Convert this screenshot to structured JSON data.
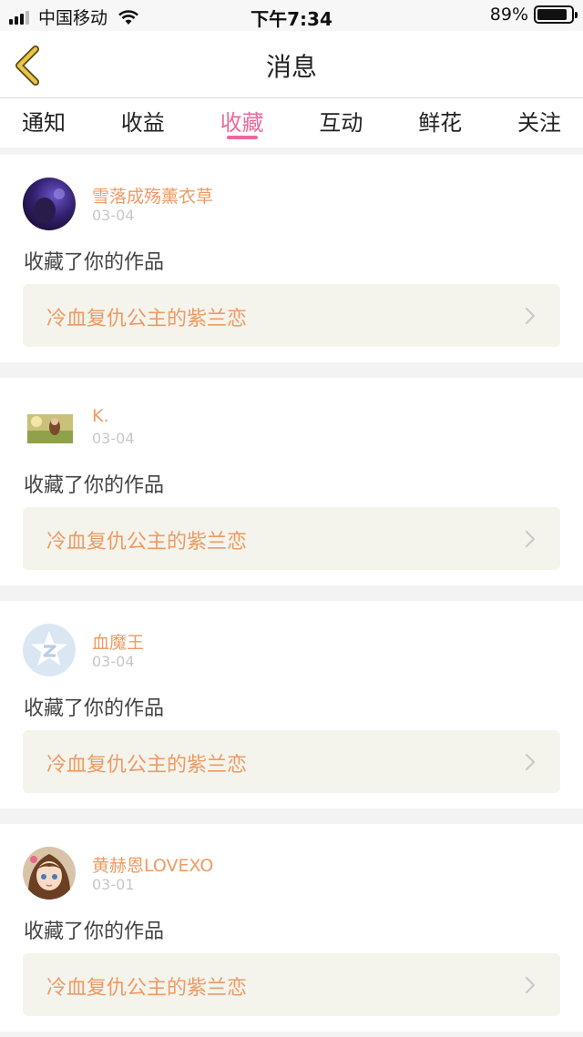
{
  "status_bar": {
    "carrier": "中国移动",
    "time": "下午7:34",
    "battery": "89%",
    "battery_level": 0.89
  },
  "nav": {
    "title": "消息",
    "back_icon": "chevron-left-icon"
  },
  "tabs": [
    {
      "label": "通知",
      "active": false
    },
    {
      "label": "收益",
      "active": false
    },
    {
      "label": "收藏",
      "active": true
    },
    {
      "label": "互动",
      "active": false
    },
    {
      "label": "鲜花",
      "active": false
    },
    {
      "label": "关注",
      "active": false
    }
  ],
  "feed": [
    {
      "username": "雪落成殇薰衣草",
      "date": "03-04",
      "action": "收藏了你的作品",
      "work_title": "冷血复仇公主的紫兰恋",
      "avatar": "avatar-purple-photo"
    },
    {
      "username": "K.",
      "date": "03-04",
      "action": "收藏了你的作品",
      "work_title": "冷血复仇公主的紫兰恋",
      "avatar": "avatar-landscape-photo"
    },
    {
      "username": "血魔王",
      "date": "03-04",
      "action": "收藏了你的作品",
      "work_title": "冷血复仇公主的紫兰恋",
      "avatar": "avatar-default-star"
    },
    {
      "username": "黄赫恩LOVEXO",
      "date": "03-01",
      "action": "收藏了你的作品",
      "work_title": "冷血复仇公主的紫兰恋",
      "avatar": "avatar-anime-girl"
    }
  ],
  "colors": {
    "accent": "#e96aa0",
    "username": "#ee9a64",
    "back_arrow": "#e8c44a",
    "link_bg": "#f4f4ec"
  }
}
